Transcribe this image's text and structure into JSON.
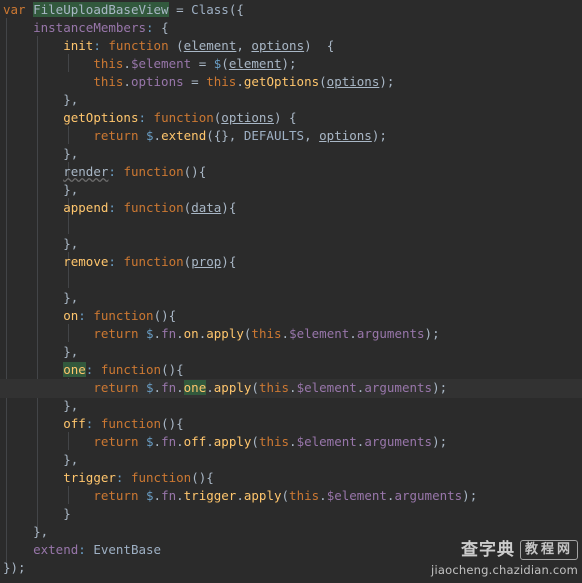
{
  "editor": {
    "language": "JavaScript",
    "theme": "Darcula",
    "background_color": "#2b2b2b",
    "current_line_color": "#323232",
    "occurrence_highlight_color": "#32593d",
    "default_text_color": "#a9b7c6",
    "keyword_color": "#cc7832",
    "field_color": "#9876aa",
    "method_color": "#ffc66d",
    "constant_color": "#9eb0c4",
    "indent_guide_color": "#434548",
    "highlighted_symbol": "one",
    "current_line_number": 22,
    "lines": [
      "var FileUploadBaseView = Class({",
      "    instanceMembers: {",
      "        init: function (element, options)  {",
      "            this.$element = $(element);",
      "            this.options = this.getOptions(options);",
      "        },",
      "        getOptions: function(options) {",
      "            return $.extend({}, DEFAULTS, options);",
      "        },",
      "        render: function(){",
      "        },",
      "        append: function(data){",
      "",
      "        },",
      "        remove: function(prop){",
      "",
      "        },",
      "        on: function(){",
      "            return $.fn.on.apply(this.$element.arguments);",
      "        },",
      "        one: function(){",
      "            return $.fn.one.apply(this.$element.arguments);",
      "        },",
      "        off: function(){",
      "            return $.fn.off.apply(this.$element.arguments);",
      "        },",
      "        trigger: function(){",
      "            return $.fn.trigger.apply(this.$element.arguments);",
      "        }",
      "    },",
      "    extend: EventBase",
      "});"
    ]
  },
  "watermark": {
    "title_cn": "查字典",
    "badge_cn": "教程网",
    "url": "jiaocheng.chazidian.com"
  }
}
